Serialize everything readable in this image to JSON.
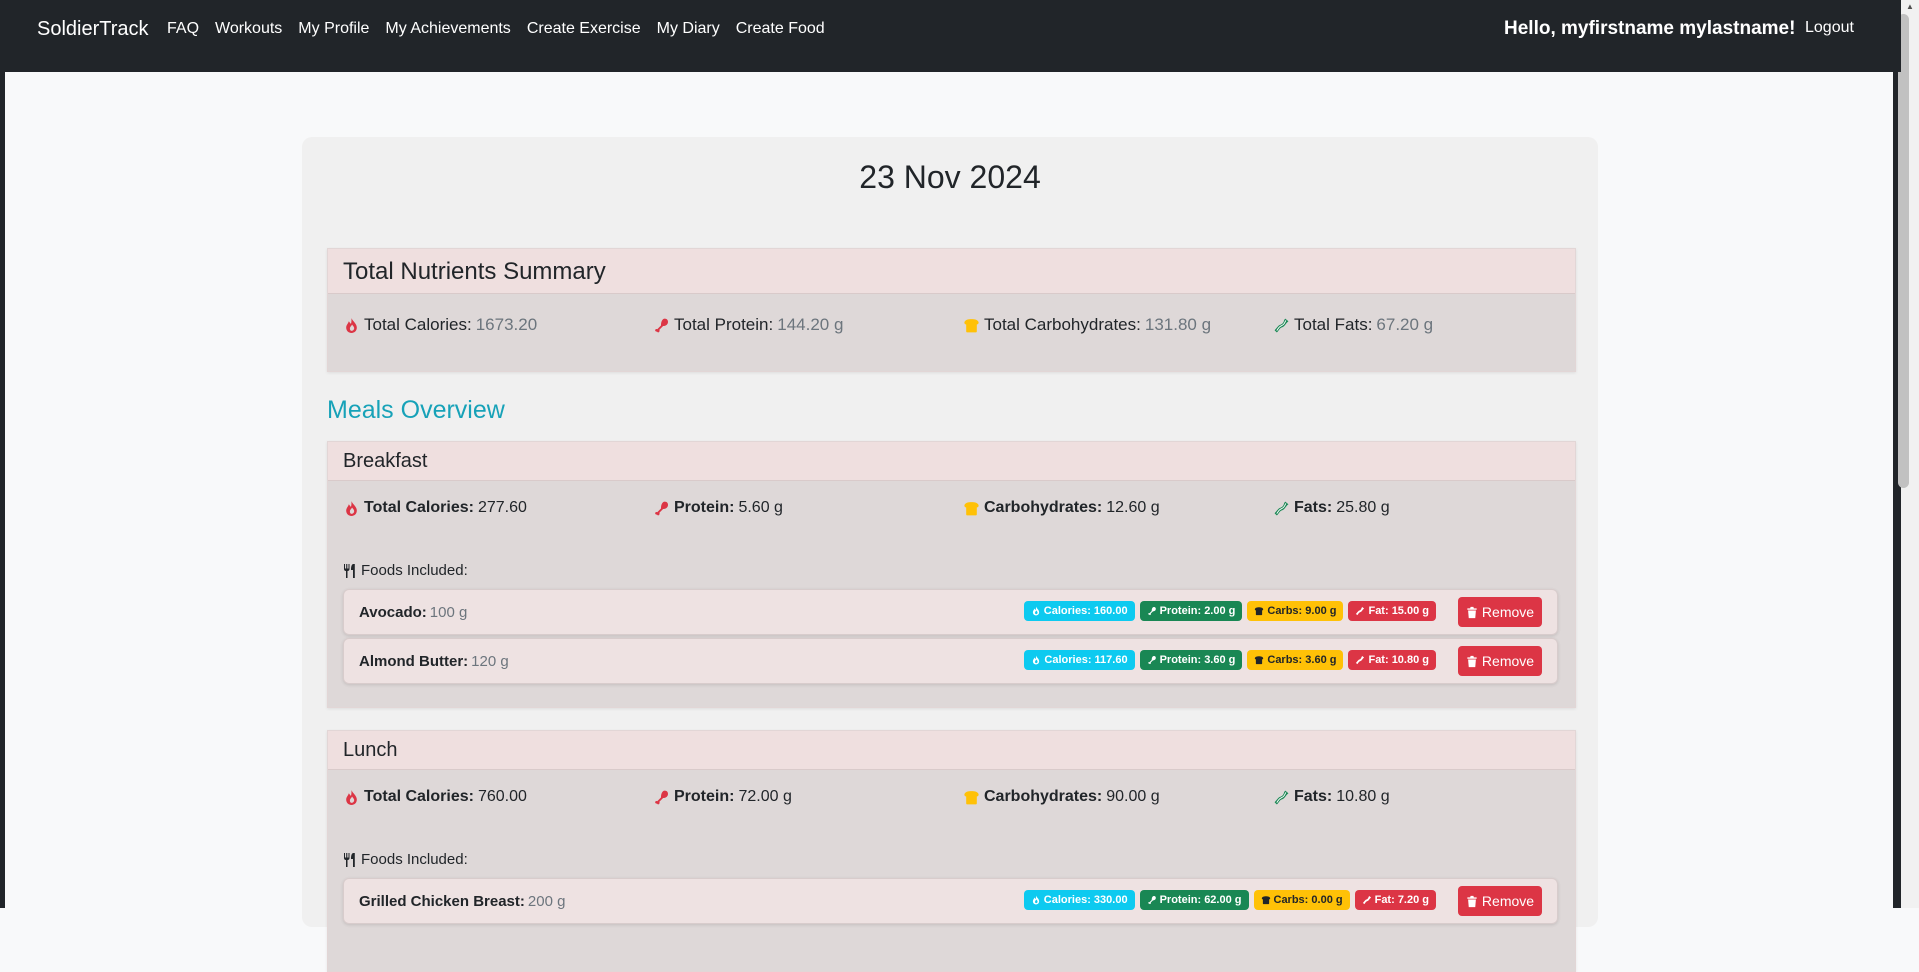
{
  "navbar": {
    "brand": "SoldierTrack",
    "links": [
      "FAQ",
      "Workouts",
      "My Profile",
      "My Achievements",
      "Create Exercise",
      "My Diary",
      "Create Food"
    ],
    "greeting": "Hello, myfirstname mylastname!",
    "logout": "Logout"
  },
  "diary": {
    "date": "23 Nov 2024",
    "summary": {
      "title": "Total Nutrients Summary",
      "calories_label": "Total Calories:",
      "calories": "1673.20",
      "protein_label": "Total Protein:",
      "protein": "144.20 g",
      "carbs_label": "Total Carbohydrates:",
      "carbs": "131.80 g",
      "fats_label": "Total Fats:",
      "fats": "67.20 g"
    },
    "meals_title": "Meals Overview",
    "meals": [
      {
        "name": "Breakfast",
        "calories_label": "Total Calories:",
        "calories": "277.60",
        "protein_label": "Protein:",
        "protein": "5.60 g",
        "carbs_label": "Carbohydrates:",
        "carbs": "12.60 g",
        "fats_label": "Fats:",
        "fats": "25.80 g",
        "foods_label": "Foods Included:",
        "foods": [
          {
            "name": "Avocado:",
            "amount": "100 g",
            "calories": "Calories: 160.00",
            "protein": "Protein: 2.00 g",
            "carbs": "Carbs: 9.00 g",
            "fat": "Fat: 15.00 g",
            "remove": "Remove"
          },
          {
            "name": "Almond Butter:",
            "amount": "120 g",
            "calories": "Calories: 117.60",
            "protein": "Protein: 3.60 g",
            "carbs": "Carbs: 3.60 g",
            "fat": "Fat: 10.80 g",
            "remove": "Remove"
          }
        ]
      },
      {
        "name": "Lunch",
        "calories_label": "Total Calories:",
        "calories": "760.00",
        "protein_label": "Protein:",
        "protein": "72.00 g",
        "carbs_label": "Carbohydrates:",
        "carbs": "90.00 g",
        "fats_label": "Fats:",
        "fats": "10.80 g",
        "foods_label": "Foods Included:",
        "foods": [
          {
            "name": "Grilled Chicken Breast:",
            "amount": "200 g",
            "calories": "Calories: 330.00",
            "protein": "Protein: 62.00 g",
            "carbs": "Carbs: 0.00 g",
            "fat": "Fat: 7.20 g",
            "remove": "Remove"
          }
        ]
      }
    ]
  },
  "colors": {
    "navbar": "#212529",
    "calories": "#0dcaf0",
    "protein": "#198754",
    "carbs": "#ffc107",
    "fat": "#dc3545",
    "accent": "#17a2b8"
  },
  "icons": {
    "calories": "fire-icon",
    "protein": "drumstick-icon",
    "carbs": "bread-icon",
    "fats": "bacon-icon",
    "foods": "utensils-icon",
    "remove": "trash-icon"
  }
}
